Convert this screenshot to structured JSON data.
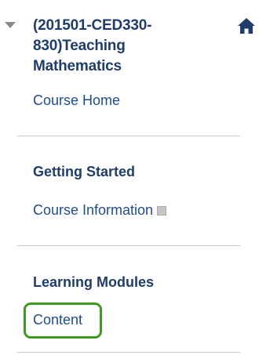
{
  "course": {
    "title_line1": "(201501-CED330-",
    "title_line2": "830)Teaching",
    "title_line3": "Mathematics",
    "home_link": "Course Home"
  },
  "sections": [
    {
      "heading": "Getting Started",
      "items": [
        {
          "label": "Course Information"
        }
      ]
    },
    {
      "heading": "Learning Modules",
      "items": [
        {
          "label": "Content"
        }
      ]
    }
  ],
  "colors": {
    "title": "#1f3d6b",
    "link": "#1f4e8c",
    "highlight": "#3d9a1e",
    "divider": "#c9c9c9"
  },
  "icons": {
    "collapse": "triangle-down-icon",
    "home": "home-icon",
    "info_indicator": "square-icon"
  }
}
